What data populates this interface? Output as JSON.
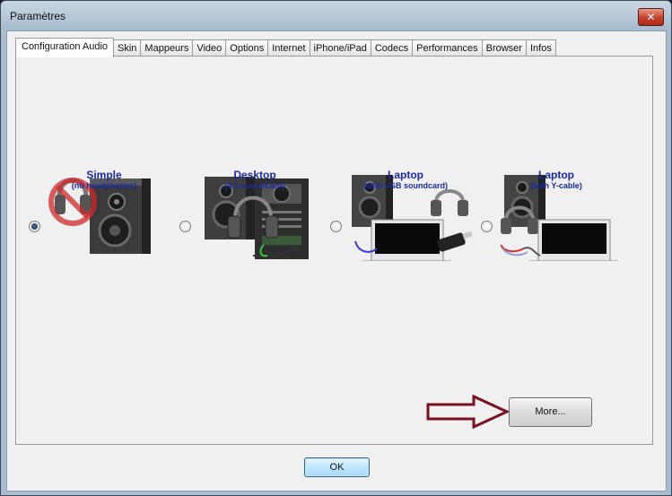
{
  "window": {
    "title": "Paramètres",
    "close_glyph": "✕"
  },
  "tabs": [
    {
      "label": "Configuration Audio",
      "active": true
    },
    {
      "label": "Skin"
    },
    {
      "label": "Mappeurs"
    },
    {
      "label": "Video"
    },
    {
      "label": "Options"
    },
    {
      "label": "Internet"
    },
    {
      "label": "iPhone/iPad"
    },
    {
      "label": "Codecs"
    },
    {
      "label": "Performances"
    },
    {
      "label": "Browser"
    },
    {
      "label": "Infos"
    }
  ],
  "options": [
    {
      "title": "Simple",
      "subtitle": "(no headphones)",
      "selected": true,
      "icon": "speaker-no-headphones-icon"
    },
    {
      "title": "Desktop",
      "subtitle": "(4.1 soundcard)",
      "selected": false,
      "icon": "desktop-soundcard-icon"
    },
    {
      "title": "Laptop",
      "subtitle": "(with USB soundcard)",
      "selected": false,
      "icon": "laptop-usb-soundcard-icon"
    },
    {
      "title": "Laptop",
      "subtitle": "(with Y-cable)",
      "selected": false,
      "icon": "laptop-y-cable-icon"
    }
  ],
  "buttons": {
    "more": "More...",
    "ok": "OK"
  },
  "colors": {
    "option_text": "#1a2aa0",
    "arrow": "#7a1020"
  }
}
